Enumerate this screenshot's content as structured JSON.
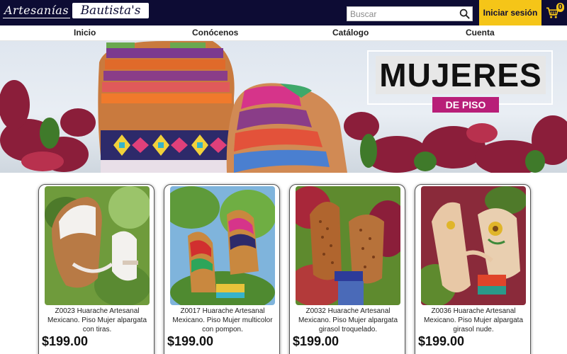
{
  "header": {
    "logo_part1": "Artesanías",
    "logo_part2": "Bautista's",
    "search_placeholder": "Buscar",
    "login_label": "Iniciar sesión",
    "cart_count": "0"
  },
  "nav": {
    "items": [
      {
        "label": "Inicio"
      },
      {
        "label": "Conócenos"
      },
      {
        "label": "Catálogo"
      },
      {
        "label": "Cuenta"
      }
    ]
  },
  "hero": {
    "promo_title": "MUJERES",
    "promo_subtitle": "DE PISO"
  },
  "products": [
    {
      "description": "Z0023 Huarache Artesanal Mexicano. Piso Mujer alpargata con tiras.",
      "price": "$199.00"
    },
    {
      "description": "Z0017 Huarache Artesanal Mexicano. Piso Mujer multicolor con pompon.",
      "price": "$199.00"
    },
    {
      "description": "Z0032 Huarache Artesanal Mexicano. Piso Mujer alpargata girasol troquelado.",
      "price": "$199.00"
    },
    {
      "description": "Z0036 Huarache Artesanal Mexicano. Piso Mujer alpargata girasol nude.",
      "price": "$199.00"
    }
  ],
  "colors": {
    "header_bg": "#0d0c34",
    "login_bg": "#f5c518",
    "promo_badge": "#b81e78"
  },
  "icons": {
    "search": "search-icon",
    "cart": "cart-icon"
  }
}
